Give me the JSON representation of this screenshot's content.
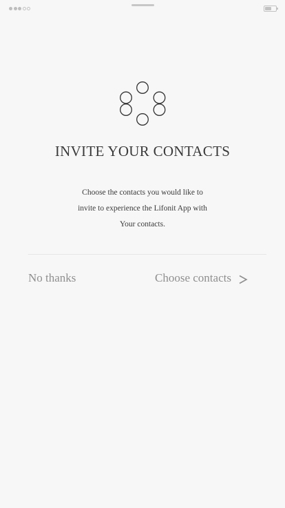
{
  "status_bar": {
    "signal_strength_bars": 3,
    "signal_total_bars": 5,
    "battery_level": 0.6,
    "signal_icon": "signal-dots-icon",
    "battery_icon": "battery-icon"
  },
  "logo": {
    "icon": "circles-logo-icon"
  },
  "invite": {
    "title": "INVITE YOUR CONTACTS",
    "description_line1": "Choose the contacts you would like to",
    "description_line2": "invite to experience the Lifonit App with",
    "description_line3": "Your contacts."
  },
  "actions": {
    "no_thanks_label": "No thanks",
    "choose_contacts_label": "Choose contacts",
    "choose_icon": "chevron-right-icon"
  },
  "colors": {
    "background": "#f7f7f7",
    "text": "#3a3a3a",
    "muted": "#8f8f8f"
  }
}
